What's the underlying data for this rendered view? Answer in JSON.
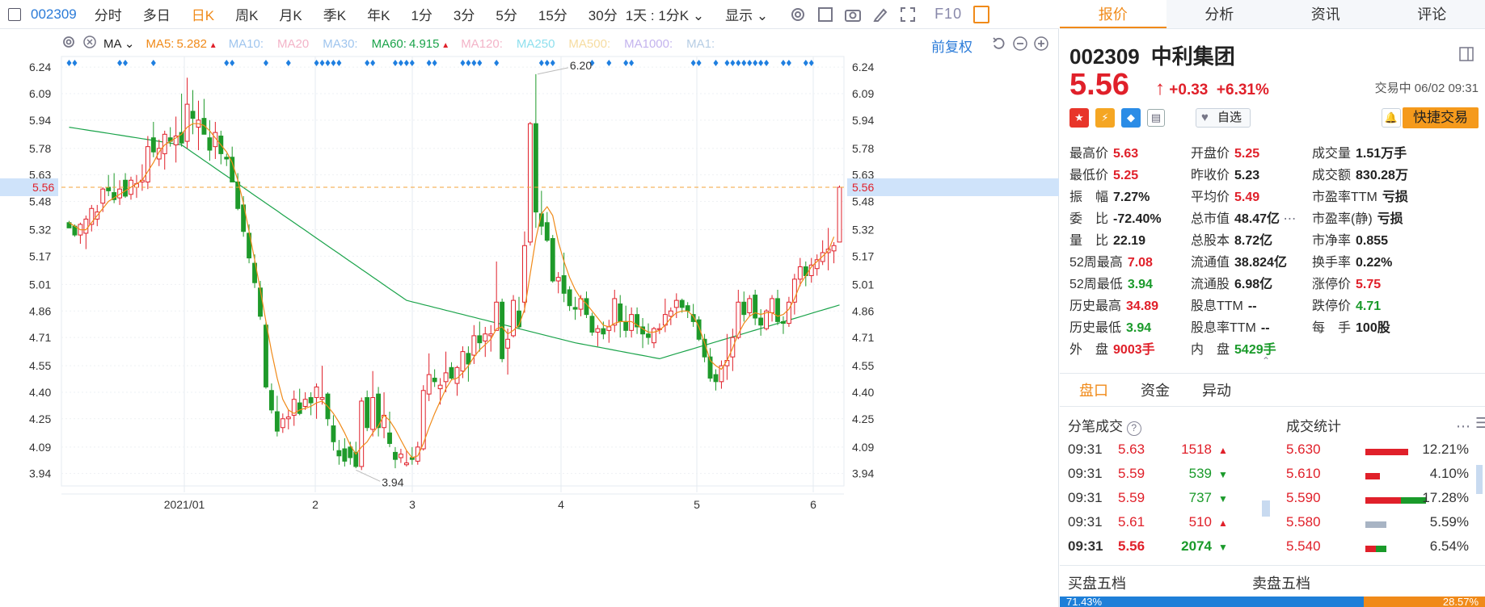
{
  "toolbar": {
    "code": "002309",
    "periods": [
      "分时",
      "多日",
      "日K",
      "周K",
      "月K",
      "季K",
      "年K",
      "1分",
      "3分",
      "5分",
      "15分",
      "30分"
    ],
    "active_period": "日K",
    "interval_label": "1天 : 1分K",
    "display_label": "显示",
    "f10_label": "F10"
  },
  "ma_line": {
    "name": "MA",
    "items": [
      {
        "label": "MA5:",
        "value": "5.282",
        "color": "#f08a19",
        "arrow": "up"
      },
      {
        "label": "MA10:",
        "value": "",
        "color": "#9fc5ee"
      },
      {
        "label": "MA20",
        "value": "",
        "color": "#f3b4c8"
      },
      {
        "label": "MA30:",
        "value": "",
        "color": "#9fc5ee"
      },
      {
        "label": "MA60:",
        "value": "4.915",
        "color": "#1aa34a",
        "arrow": "up"
      },
      {
        "label": "MA120:",
        "value": "",
        "color": "#f3b4c8"
      },
      {
        "label": "MA250",
        "value": "",
        "color": "#8fe0ee"
      },
      {
        "label": "MA500:",
        "value": "",
        "color": "#f6dca0"
      },
      {
        "label": "MA1000:",
        "value": "",
        "color": "#c4b4ee"
      },
      {
        "label": "MA1:",
        "value": "",
        "color": "#b6cde4"
      }
    ],
    "adjust_label": "前复权"
  },
  "chart_data": {
    "type": "candlestick",
    "y_ticks": [
      "6.24",
      "6.09",
      "5.94",
      "5.78",
      "5.63",
      "5.48",
      "5.32",
      "5.17",
      "5.01",
      "4.86",
      "4.71",
      "4.55",
      "4.40",
      "4.25",
      "4.09",
      "3.94"
    ],
    "x_labels": [
      "2021/01",
      "2",
      "3",
      "4",
      "5",
      "6"
    ],
    "ylim": [
      3.87,
      6.3
    ],
    "current_price": "5.56",
    "high_annotation": "6.20",
    "low_annotation": "3.94",
    "candles": [
      [
        5.36,
        5.37,
        5.33,
        5.33
      ],
      [
        5.34,
        5.35,
        5.28,
        5.29
      ],
      [
        5.29,
        5.36,
        5.24,
        5.35
      ],
      [
        5.3,
        5.4,
        5.21,
        5.38
      ],
      [
        5.35,
        5.46,
        5.31,
        5.44
      ],
      [
        5.38,
        5.46,
        5.34,
        5.42
      ],
      [
        5.47,
        5.56,
        5.42,
        5.55
      ],
      [
        5.56,
        5.63,
        5.51,
        5.54
      ],
      [
        5.53,
        5.64,
        5.47,
        5.49
      ],
      [
        5.5,
        5.6,
        5.46,
        5.55
      ],
      [
        5.6,
        5.64,
        5.5,
        5.51
      ],
      [
        5.52,
        5.62,
        5.49,
        5.6
      ],
      [
        5.56,
        5.63,
        5.5,
        5.58
      ],
      [
        5.59,
        5.69,
        5.54,
        5.6
      ],
      [
        5.59,
        5.85,
        5.55,
        5.79
      ],
      [
        5.84,
        5.93,
        5.73,
        5.76
      ],
      [
        5.72,
        5.83,
        5.68,
        5.78
      ],
      [
        5.75,
        5.88,
        5.66,
        5.86
      ],
      [
        5.84,
        5.9,
        5.79,
        5.82
      ],
      [
        5.8,
        5.96,
        5.7,
        5.85
      ],
      [
        5.87,
        6.09,
        5.79,
        5.81
      ],
      [
        5.82,
        6.18,
        5.78,
        6.03
      ],
      [
        5.99,
        6.11,
        5.86,
        5.95
      ],
      [
        5.9,
        6.05,
        5.77,
        5.94
      ],
      [
        5.95,
        6.06,
        5.87,
        5.86
      ],
      [
        5.84,
        5.94,
        5.71,
        5.77
      ],
      [
        5.79,
        5.93,
        5.72,
        5.87
      ],
      [
        5.85,
        5.88,
        5.69,
        5.75
      ],
      [
        5.73,
        5.75,
        5.68,
        5.72
      ],
      [
        5.73,
        5.79,
        5.63,
        5.59
      ],
      [
        5.59,
        5.64,
        5.43,
        5.44
      ],
      [
        5.46,
        5.51,
        5.28,
        5.31
      ],
      [
        5.3,
        5.35,
        5.13,
        5.16
      ],
      [
        5.13,
        5.18,
        4.99,
        5.02
      ],
      [
        4.99,
        5.03,
        4.81,
        4.83
      ],
      [
        4.78,
        4.8,
        4.42,
        4.43
      ],
      [
        4.41,
        4.45,
        4.28,
        4.3
      ],
      [
        4.29,
        4.38,
        4.15,
        4.18
      ],
      [
        4.2,
        4.28,
        4.17,
        4.25
      ],
      [
        4.25,
        4.3,
        4.19,
        4.26
      ],
      [
        4.27,
        4.41,
        4.21,
        4.36
      ],
      [
        4.34,
        4.42,
        4.27,
        4.28
      ],
      [
        4.32,
        4.4,
        4.3,
        4.36
      ],
      [
        4.37,
        4.4,
        4.27,
        4.34
      ],
      [
        4.37,
        4.45,
        4.25,
        4.43
      ],
      [
        4.36,
        4.55,
        4.33,
        4.37
      ],
      [
        4.39,
        4.4,
        4.21,
        4.25
      ],
      [
        4.21,
        4.27,
        4.07,
        4.12
      ],
      [
        4.07,
        4.13,
        3.99,
        4.04
      ],
      [
        4.08,
        4.14,
        3.98,
        4.01
      ],
      [
        4.09,
        4.12,
        3.99,
        4.03
      ],
      [
        4.06,
        4.12,
        3.97,
        3.98
      ],
      [
        3.98,
        4.37,
        3.96,
        4.35
      ],
      [
        4.37,
        4.41,
        4.18,
        4.2
      ],
      [
        4.19,
        4.52,
        4.15,
        4.37
      ],
      [
        4.39,
        4.43,
        4.15,
        4.2
      ],
      [
        4.2,
        4.4,
        4.14,
        4.27
      ],
      [
        4.17,
        4.29,
        4.09,
        4.11
      ],
      [
        4.06,
        4.09,
        3.97,
        4.02
      ],
      [
        4.03,
        4.08,
        4.0,
        4.05
      ],
      [
        3.99,
        4.07,
        3.98,
        4.0
      ],
      [
        4.03,
        4.09,
        3.99,
        4.02
      ],
      [
        4.01,
        4.12,
        3.99,
        4.09
      ],
      [
        4.08,
        4.44,
        4.07,
        4.41
      ],
      [
        4.39,
        4.62,
        4.35,
        4.5
      ],
      [
        4.48,
        4.53,
        4.43,
        4.46
      ],
      [
        4.42,
        4.48,
        4.33,
        4.44
      ],
      [
        4.46,
        4.63,
        4.4,
        4.51
      ],
      [
        4.54,
        4.57,
        4.47,
        4.48
      ],
      [
        4.45,
        4.55,
        4.38,
        4.54
      ],
      [
        4.52,
        4.66,
        4.48,
        4.63
      ],
      [
        4.62,
        4.66,
        4.46,
        4.56
      ],
      [
        4.61,
        4.78,
        4.56,
        4.72
      ],
      [
        4.72,
        4.8,
        4.63,
        4.68
      ],
      [
        4.69,
        4.77,
        4.6,
        4.73
      ],
      [
        4.72,
        4.78,
        4.63,
        4.73
      ],
      [
        4.75,
        5.14,
        4.75,
        4.91
      ],
      [
        4.91,
        4.93,
        4.57,
        4.59
      ],
      [
        4.65,
        4.76,
        4.5,
        4.7
      ],
      [
        4.72,
        4.95,
        4.71,
        4.92
      ],
      [
        4.86,
        4.94,
        4.76,
        4.77
      ],
      [
        4.91,
        5.31,
        4.85,
        5.23
      ],
      [
        5.25,
        5.93,
        5.23,
        5.92
      ],
      [
        5.92,
        6.2,
        5.33,
        5.42
      ],
      [
        5.41,
        5.54,
        5.29,
        5.34
      ],
      [
        5.36,
        5.42,
        5.25,
        5.26
      ],
      [
        5.27,
        5.29,
        5.02,
        5.03
      ],
      [
        5.03,
        5.08,
        4.96,
        5.05
      ],
      [
        5.06,
        5.19,
        4.91,
        4.96
      ],
      [
        4.98,
        5.0,
        4.86,
        4.89
      ],
      [
        4.88,
        4.94,
        4.81,
        4.87
      ],
      [
        4.87,
        4.95,
        4.83,
        4.93
      ],
      [
        4.93,
        4.97,
        4.82,
        4.84
      ],
      [
        4.83,
        4.85,
        4.72,
        4.74
      ],
      [
        4.74,
        4.78,
        4.66,
        4.76
      ],
      [
        4.76,
        4.8,
        4.7,
        4.73
      ],
      [
        4.75,
        4.81,
        4.68,
        4.77
      ],
      [
        4.78,
        4.98,
        4.74,
        4.93
      ],
      [
        4.9,
        4.95,
        4.71,
        4.8
      ],
      [
        4.8,
        4.89,
        4.71,
        4.75
      ],
      [
        4.75,
        4.88,
        4.71,
        4.84
      ],
      [
        4.84,
        4.88,
        4.73,
        4.77
      ],
      [
        4.77,
        4.82,
        4.65,
        4.73
      ],
      [
        4.73,
        4.79,
        4.67,
        4.71
      ],
      [
        4.68,
        4.77,
        4.65,
        4.76
      ],
      [
        4.76,
        4.79,
        4.73,
        4.76
      ],
      [
        4.78,
        4.93,
        4.74,
        4.84
      ],
      [
        4.83,
        4.88,
        4.78,
        4.86
      ],
      [
        4.88,
        4.96,
        4.82,
        4.92
      ],
      [
        4.92,
        4.93,
        4.85,
        4.88
      ],
      [
        4.89,
        4.91,
        4.82,
        4.86
      ],
      [
        4.84,
        4.9,
        4.77,
        4.8
      ],
      [
        4.81,
        4.83,
        4.69,
        4.7
      ],
      [
        4.7,
        4.73,
        4.57,
        4.6
      ],
      [
        4.6,
        4.65,
        4.46,
        4.48
      ],
      [
        4.5,
        4.53,
        4.41,
        4.46
      ],
      [
        4.46,
        4.58,
        4.42,
        4.55
      ],
      [
        4.55,
        4.73,
        4.47,
        4.58
      ],
      [
        4.6,
        4.76,
        4.52,
        4.71
      ],
      [
        4.71,
        4.98,
        4.7,
        4.91
      ],
      [
        4.91,
        4.97,
        4.8,
        4.84
      ],
      [
        4.85,
        4.95,
        4.83,
        4.93
      ],
      [
        4.95,
        4.98,
        4.78,
        4.82
      ],
      [
        4.82,
        4.87,
        4.72,
        4.78
      ],
      [
        4.76,
        4.87,
        4.75,
        4.86
      ],
      [
        4.85,
        4.95,
        4.8,
        4.93
      ],
      [
        4.93,
        4.98,
        4.78,
        4.8
      ],
      [
        4.8,
        4.83,
        4.73,
        4.79
      ],
      [
        4.79,
        4.94,
        4.77,
        4.91
      ],
      [
        4.91,
        5.07,
        4.84,
        5.04
      ],
      [
        5.04,
        5.16,
        5.0,
        5.11
      ],
      [
        5.11,
        5.14,
        5.0,
        5.06
      ],
      [
        5.06,
        5.16,
        5.02,
        5.12
      ],
      [
        5.1,
        5.18,
        5.06,
        5.15
      ],
      [
        5.14,
        5.26,
        5.12,
        5.19
      ],
      [
        5.19,
        5.33,
        5.09,
        5.21
      ],
      [
        5.2,
        5.25,
        5.13,
        5.23
      ],
      [
        5.25,
        5.57,
        5.25,
        5.56
      ]
    ],
    "ma5": [
      5.36,
      5.34,
      5.32,
      5.32,
      5.36,
      5.4,
      5.44,
      5.48,
      5.5,
      5.52,
      5.54,
      5.56,
      5.58,
      5.6,
      5.65,
      5.7,
      5.76,
      5.8,
      5.82,
      5.84,
      5.86,
      5.9,
      5.92,
      5.92,
      5.91,
      5.88,
      5.84,
      5.8,
      5.76,
      5.7,
      5.6,
      5.47,
      5.31,
      5.15,
      4.98,
      4.8,
      4.63,
      4.48,
      4.36,
      4.3,
      4.28,
      4.3,
      4.31,
      4.32,
      4.34,
      4.35,
      4.32,
      4.28,
      4.23,
      4.17,
      4.1,
      4.05,
      4.09,
      4.12,
      4.17,
      4.21,
      4.27,
      4.24,
      4.19,
      4.13,
      4.07,
      4.03,
      4.04,
      4.11,
      4.2,
      4.28,
      4.35,
      4.42,
      4.47,
      4.48,
      4.51,
      4.55,
      4.6,
      4.64,
      4.67,
      4.7,
      4.76,
      4.77,
      4.73,
      4.75,
      4.78,
      4.87,
      5.07,
      5.27,
      5.41,
      5.45,
      5.4,
      5.25,
      5.14,
      5.05,
      4.98,
      4.93,
      4.9,
      4.86,
      4.82,
      4.78,
      4.77,
      4.79,
      4.8,
      4.8,
      4.8,
      4.78,
      4.76,
      4.74,
      4.74,
      4.75,
      4.78,
      4.82,
      4.85,
      4.86,
      4.86,
      4.83,
      4.77,
      4.68,
      4.58,
      4.55,
      4.53,
      4.58,
      4.65,
      4.73,
      4.79,
      4.83,
      4.85,
      4.84,
      4.85,
      4.85,
      4.83,
      4.84,
      4.87,
      4.93,
      5.01,
      5.06,
      5.11,
      5.14,
      5.17,
      5.2,
      5.28
    ]
  },
  "quote": {
    "code": "002309",
    "name": "中利集团",
    "price": "5.56",
    "arrow": "↑",
    "change": "+0.33",
    "change_pct": "+6.31%",
    "status": "交易中 06/02 09:31",
    "add_watch": "自选",
    "quick_trade": "快捷交易"
  },
  "stats": [
    [
      {
        "l": "最高价",
        "v": "5.63",
        "c": "red"
      },
      {
        "l": "开盘价",
        "v": "5.25",
        "c": "red"
      },
      {
        "l": "成交量",
        "v": "1.51万手",
        "c": "dark"
      }
    ],
    [
      {
        "l": "最低价",
        "v": "5.25",
        "c": "red"
      },
      {
        "l": "昨收价",
        "v": "5.23",
        "c": "dark"
      },
      {
        "l": "成交额",
        "v": "830.28万",
        "c": "dark"
      }
    ],
    [
      {
        "l": "振　幅",
        "v": "7.27%",
        "c": "dark"
      },
      {
        "l": "平均价",
        "v": "5.49",
        "c": "red"
      },
      {
        "l": "市盈率TTM",
        "v": "亏损",
        "c": "dark"
      }
    ],
    [
      {
        "l": "委　比",
        "v": "-72.40%",
        "c": "dark"
      },
      {
        "l": "总市值",
        "v": "48.47亿",
        "c": "dark"
      },
      {
        "l": "市盈率(静)",
        "v": "亏损",
        "c": "dark"
      }
    ],
    [
      {
        "l": "量　比",
        "v": "22.19",
        "c": "dark"
      },
      {
        "l": "总股本",
        "v": "8.72亿",
        "c": "dark"
      },
      {
        "l": "市净率",
        "v": "0.855",
        "c": "dark"
      }
    ],
    [
      {
        "l": "52周最高",
        "v": "7.08",
        "c": "red"
      },
      {
        "l": "流通值",
        "v": "38.824亿",
        "c": "dark"
      },
      {
        "l": "换手率",
        "v": "0.22%",
        "c": "dark"
      }
    ],
    [
      {
        "l": "52周最低",
        "v": "3.94",
        "c": "green"
      },
      {
        "l": "流通股",
        "v": "6.98亿",
        "c": "dark"
      },
      {
        "l": "涨停价",
        "v": "5.75",
        "c": "red"
      }
    ],
    [
      {
        "l": "历史最高",
        "v": "34.89",
        "c": "red"
      },
      {
        "l": "股息TTM",
        "v": "--",
        "c": "dark"
      },
      {
        "l": "跌停价",
        "v": "4.71",
        "c": "green"
      }
    ],
    [
      {
        "l": "历史最低",
        "v": "3.94",
        "c": "green"
      },
      {
        "l": "股息率TTM",
        "v": "--",
        "c": "dark"
      },
      {
        "l": "每　手",
        "v": "100股",
        "c": "dark"
      }
    ],
    [
      {
        "l": "外　盘",
        "v": "9003手",
        "c": "red"
      },
      {
        "l": "内　盘",
        "v": "5429手",
        "c": "green"
      },
      {
        "l": "",
        "v": "",
        "c": "dark"
      }
    ]
  ],
  "tabs": [
    "报价",
    "分析",
    "资讯",
    "评论"
  ],
  "subtabs": [
    "盘口",
    "资金",
    "异动"
  ],
  "trades_title": "分笔成交",
  "trades": [
    {
      "t": "09:31",
      "p": "5.63",
      "v": "1518",
      "dir": "up"
    },
    {
      "t": "09:31",
      "p": "5.59",
      "v": "539",
      "dir": "down"
    },
    {
      "t": "09:31",
      "p": "5.59",
      "v": "737",
      "dir": "down"
    },
    {
      "t": "09:31",
      "p": "5.61",
      "v": "510",
      "dir": "up"
    },
    {
      "t": "09:31",
      "p": "5.56",
      "v": "2074",
      "dir": "down"
    }
  ],
  "dist_title": "成交统计",
  "dist": [
    {
      "p": "5.630",
      "pct": "12.21%",
      "red": 0.12,
      "green": 0
    },
    {
      "p": "5.610",
      "pct": "4.10%",
      "red": 0.04,
      "green": 0
    },
    {
      "p": "5.590",
      "pct": "17.28%",
      "red": 0.1,
      "green": 0.07
    },
    {
      "p": "5.580",
      "pct": "5.59%",
      "red": 0,
      "green": 0,
      "gray": 0.06
    },
    {
      "p": "5.540",
      "pct": "6.54%",
      "red": 0.03,
      "green": 0.03
    }
  ],
  "book": {
    "buy_label": "买盘五档",
    "sell_label": "卖盘五档",
    "buy_pct": "71.43%",
    "sell_pct": "28.57%"
  }
}
